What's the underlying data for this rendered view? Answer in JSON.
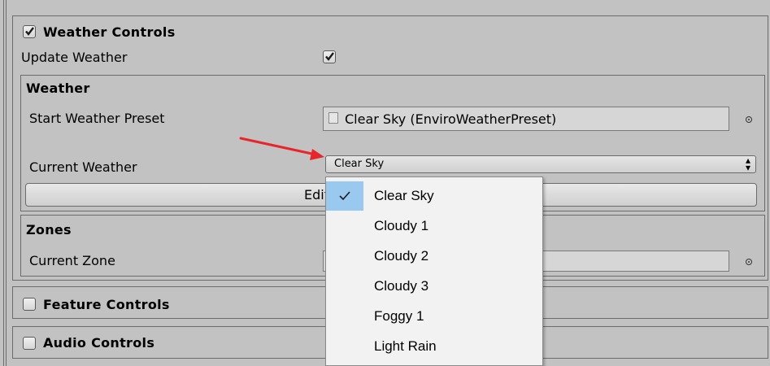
{
  "weather_controls": {
    "title": "Weather Controls",
    "enabled": true,
    "update_weather_label": "Update Weather",
    "update_weather_checked": true
  },
  "weather": {
    "title": "Weather",
    "start_preset_label": "Start Weather Preset",
    "start_preset_value": "Clear Sky (EnviroWeatherPreset)",
    "current_weather_label": "Current Weather",
    "current_weather_value": "Clear Sky",
    "edit_button_label": "Edit c"
  },
  "zones": {
    "title": "Zones",
    "current_zone_label": "Current Zone",
    "current_zone_value": ""
  },
  "feature_controls": {
    "title": "Feature Controls",
    "enabled": false
  },
  "audio_controls": {
    "title": "Audio Controls",
    "enabled": false
  },
  "dropdown": {
    "items": [
      {
        "label": "Clear Sky",
        "selected": true
      },
      {
        "label": "Cloudy 1",
        "selected": false
      },
      {
        "label": "Cloudy 2",
        "selected": false
      },
      {
        "label": "Cloudy 3",
        "selected": false
      },
      {
        "label": "Foggy 1",
        "selected": false
      },
      {
        "label": "Light Rain",
        "selected": false
      }
    ]
  },
  "annotation": {
    "color": "#e8262a"
  },
  "colors": {
    "panel_bg": "#c2c2c2",
    "popup_bg": "#f2f2f2",
    "selection": "#99c9ef"
  }
}
